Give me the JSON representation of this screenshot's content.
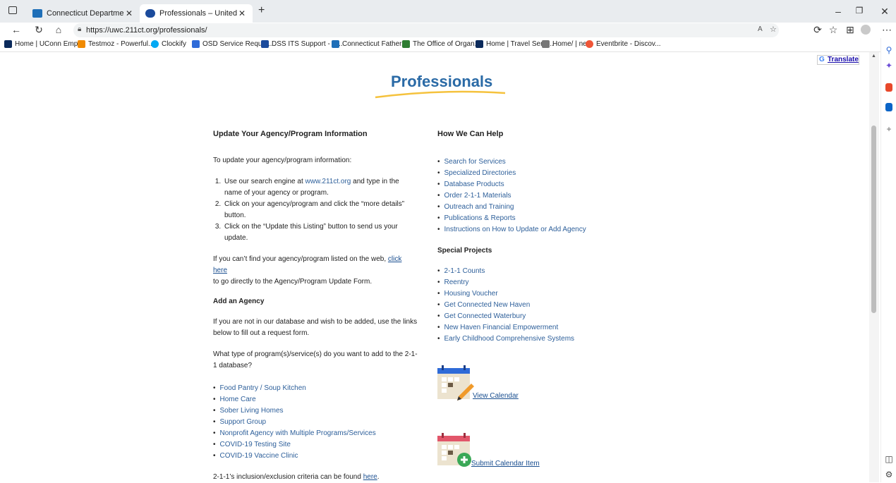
{
  "browser": {
    "tabs": [
      {
        "title": "Connecticut Department of Soci"
      },
      {
        "title": "Professionals – United Way of Co"
      }
    ],
    "url": "https://uwc.211ct.org/professionals/",
    "bookmarks": [
      "Home | UConn Emp...",
      "Testmoz - Powerful...",
      "Clockify",
      "OSD Service Reque...",
      "DSS ITS Support - S...",
      "Connecticut Father...",
      "The Office of Organ...",
      "Home | Travel Servi...",
      "Home/ | nefc",
      "Eventbrite - Discov..."
    ]
  },
  "page": {
    "translate": "Translate",
    "title": "Professionals",
    "left": {
      "heading": "Update Your Agency/Program Information",
      "intro": "To update your agency/program information:",
      "steps": [
        {
          "pre": "Use our search engine at ",
          "link": "www.211ct.org",
          "post": " and type in the name of your agency or program."
        },
        {
          "pre": "Click on your agency/program and click the “more details” button.",
          "link": "",
          "post": ""
        },
        {
          "pre": "Click on the “Update this Listing” button to send us your update.",
          "link": "",
          "post": ""
        }
      ],
      "cant_find_pre": "If you can’t find your agency/program listed on the web, ",
      "cant_find_link": "click here",
      "cant_find_post": "to go directly to the Agency/Program Update Form.",
      "add_heading": "Add an Agency",
      "add_text": "If you are not in our database and wish to be added, use the links below to fill out a request form.",
      "question": "What type of program(s)/service(s) do you want to add to the 2-1-1 database?",
      "program_links": [
        "Food Pantry / Soup Kitchen",
        "Home Care",
        "Sober Living Homes",
        "Support Group",
        "Nonprofit Agency with Multiple Programs/Services",
        "COVID-19 Testing Site",
        "COVID-19 Vaccine Clinic"
      ],
      "criteria_pre": "2-1-1’s inclusion/exclusion criteria can be found ",
      "criteria_link": "here",
      "criteria_post": "."
    },
    "right": {
      "heading": "How We Can Help",
      "help_links": [
        "Search for Services",
        "Specialized Directories",
        "Database Products",
        "Order 2-1-1 Materials",
        "Outreach and Training",
        "Publications & Reports",
        "Instructions on How to Update or Add Agency"
      ],
      "special_heading": "Special Projects",
      "special_links": [
        "2-1-1 Counts",
        "Reentry",
        "Housing Voucher",
        "Get Connected New Haven",
        "Get Connected Waterbury",
        "New Haven Financial Empowerment",
        "Early Childhood Comprehensive Systems"
      ],
      "view_calendar": "View Calendar",
      "submit_calendar": "Submit Calendar Item"
    }
  },
  "colors": {
    "accent_blue": "#2a6aa6",
    "link": "#2d5f9a",
    "calendar_blue": "#2f6bd8",
    "calendar_red": "#e2566a",
    "plus_green": "#3aa857"
  }
}
